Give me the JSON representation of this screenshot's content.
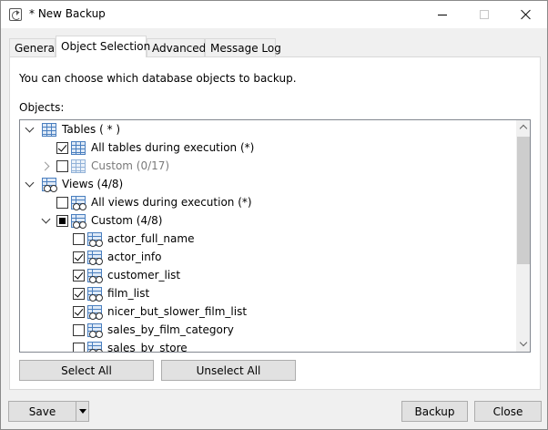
{
  "window": {
    "title": "* New Backup"
  },
  "tabs": [
    {
      "label": "General"
    },
    {
      "label": "Object Selection"
    },
    {
      "label": "Advanced"
    },
    {
      "label": "Message Log"
    }
  ],
  "panel": {
    "description": "You can choose which database objects to backup.",
    "objects_label": "Objects:"
  },
  "tree": {
    "rows": [
      {
        "label": "Tables ( * )",
        "dim": false
      },
      {
        "label": "All tables during execution (*)",
        "dim": false,
        "checked": true
      },
      {
        "label": "Custom (0/17)",
        "dim": true,
        "checked": false
      },
      {
        "label": "Views (4/8)",
        "dim": false
      },
      {
        "label": "All views during execution (*)",
        "dim": false,
        "checked": false
      },
      {
        "label": "Custom (4/8)",
        "dim": false,
        "state": "partial"
      },
      {
        "label": "actor_full_name",
        "checked": false
      },
      {
        "label": "actor_info",
        "checked": true
      },
      {
        "label": "customer_list",
        "checked": true
      },
      {
        "label": "film_list",
        "checked": true
      },
      {
        "label": "nicer_but_slower_film_list",
        "checked": true
      },
      {
        "label": "sales_by_film_category",
        "checked": false
      },
      {
        "label": "sales_by_store",
        "checked": false
      }
    ]
  },
  "buttons": {
    "select_all": "Select All",
    "unselect_all": "Unselect All",
    "save": "Save",
    "backup": "Backup",
    "close": "Close"
  },
  "colors": {
    "window_bg": "#f0f0f0",
    "panel_bg": "#ffffff",
    "icon_blue": "#4a7fbf",
    "dim_text": "#7a7a7a"
  },
  "icons": {
    "table": "table-grid-icon",
    "view": "view-glasses-icon"
  }
}
